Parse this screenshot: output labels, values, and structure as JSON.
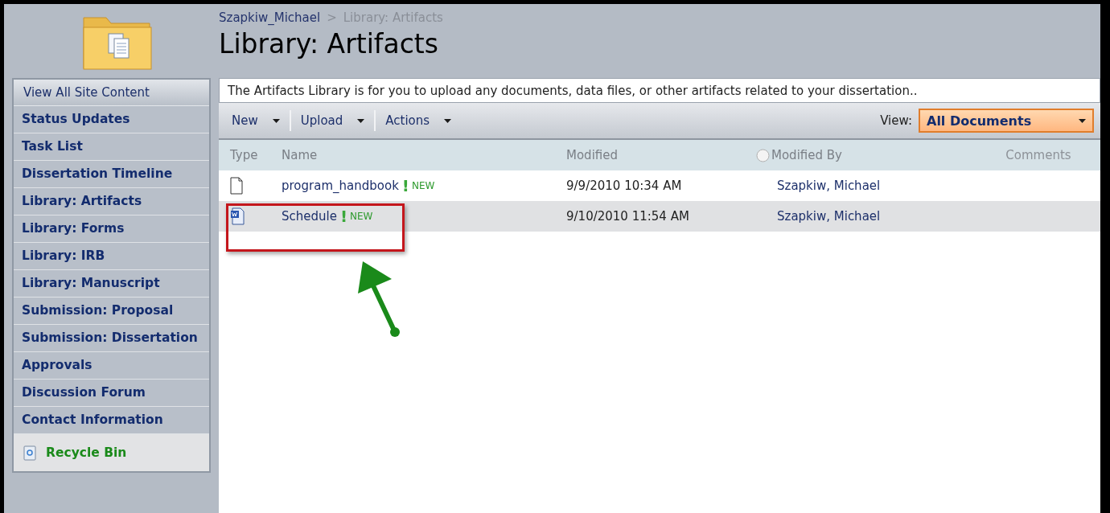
{
  "breadcrumb": {
    "site": "Szapkiw_Michael",
    "separator": ">",
    "page": "Library: Artifacts"
  },
  "title": "Library: Artifacts",
  "sidebar": {
    "header": "View All Site Content",
    "items": [
      {
        "label": "Status Updates"
      },
      {
        "label": "Task List"
      },
      {
        "label": "Dissertation Timeline"
      },
      {
        "label": "Library: Artifacts"
      },
      {
        "label": "Library: Forms"
      },
      {
        "label": "Library: IRB"
      },
      {
        "label": "Library: Manuscript"
      },
      {
        "label": "Submission: Proposal"
      },
      {
        "label": "Submission: Dissertation"
      },
      {
        "label": "Approvals"
      },
      {
        "label": "Discussion Forum"
      },
      {
        "label": "Contact Information"
      }
    ],
    "recycle_bin": "Recycle Bin"
  },
  "description": "The Artifacts Library is for you to upload any documents, data files, or other artifacts related to your dissertation..",
  "toolbar": {
    "menus": [
      "New",
      "Upload",
      "Actions"
    ],
    "view_label": "View:",
    "view_value": "All Documents"
  },
  "table": {
    "columns": [
      "Type",
      "Name",
      "Modified",
      "Modified By",
      "Comments"
    ],
    "rows": [
      {
        "kind": "blank",
        "name": "program_handbook",
        "new_mark": "!",
        "new_badge": "NEW",
        "modified": "9/9/2010 10:34 AM",
        "modified_by": "Szapkiw, Michael",
        "selected": false
      },
      {
        "kind": "word",
        "name": "Schedule",
        "new_mark": "!",
        "new_badge": "NEW",
        "modified": "9/10/2010 11:54 AM",
        "modified_by": "Szapkiw, Michael",
        "selected": true
      }
    ]
  }
}
